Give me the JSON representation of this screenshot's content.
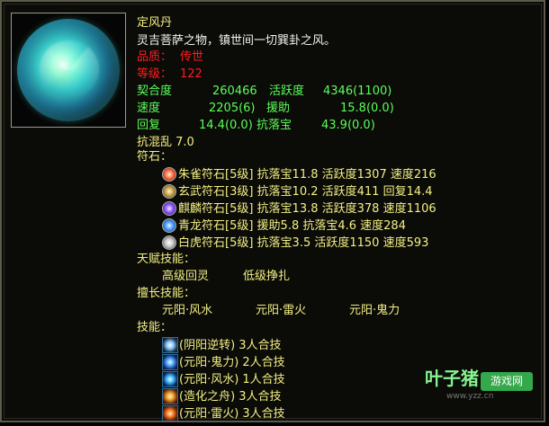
{
  "item": {
    "name": "定风丹",
    "description": "灵吉菩萨之物，镇世间一切巽卦之风。",
    "quality_label": "品质：",
    "quality_value": "传世",
    "level_label": "等级：",
    "level_value": "122",
    "stats": [
      {
        "label": "契合度",
        "v1": "260466",
        "l2": "活跃度",
        "v2": "4346(1100)"
      },
      {
        "label": "速度",
        "v1": "2205(6)",
        "l2": "援助",
        "v2": "15.8(0.0)"
      },
      {
        "label": "回复",
        "v1": "14.4(0.0)",
        "l2": "抗落宝",
        "v2": "43.9(0.0)"
      }
    ],
    "resist": "抗混乱 7.0",
    "rune_header": "符石：",
    "runes": [
      "朱雀符石[5级] 抗落宝11.8 活跃度1307 速度216",
      "玄武符石[3级] 抗落宝10.2 活跃度411 回复14.4",
      "麒麟符石[5级] 抗落宝13.8 活跃度378 速度1106",
      "青龙符石[5级] 援助5.8 抗落宝4.6 速度284",
      "白虎符石[5级] 抗落宝3.5 活跃度1150 速度593"
    ],
    "talent_header": "天赋技能：",
    "talents": [
      "高级回灵",
      "低级挣扎"
    ],
    "special_header": "擅长技能：",
    "specials": [
      "元阳·风水",
      "元阳·雷火",
      "元阳·鬼力"
    ],
    "skill_header": "技能：",
    "skills": [
      "(阴阳逆转) 3人合技",
      "(元阳·鬼力) 2人合技",
      "(元阳·风水) 1人合技",
      "(造化之舟) 3人合技",
      "(元阳·雷火) 3人合技"
    ]
  },
  "watermark": {
    "brand": "叶子猪",
    "tag": "游戏网",
    "url": "www.yzz.cn"
  },
  "colors": {
    "yellow": "#f3f083",
    "white": "#f5f5f0",
    "red": "#ff1d1d",
    "green": "#5cff5a"
  }
}
